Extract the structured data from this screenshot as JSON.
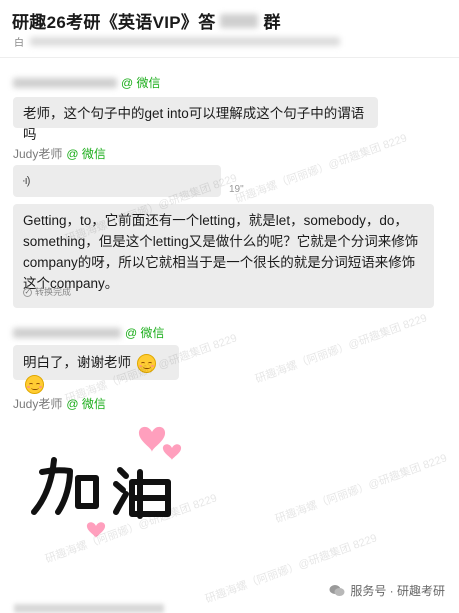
{
  "header": {
    "title": "研趣26考研《英语VIP》答",
    "title_tail": "群",
    "subtitle_prefix": "白"
  },
  "messages": [
    {
      "sender_suffix": "@ 微信",
      "text": "老师，这个句子中的get into可以理解成这个句子中的谓语吗"
    },
    {
      "sender": "Judy老师",
      "sender_suffix": "@ 微信"
    },
    {
      "sender_suffix": "@ 微信",
      "text": "明白了，谢谢老师"
    },
    {
      "sender": "Judy老师",
      "sender_suffix": "@ 微信"
    }
  ],
  "voice": {
    "duration": "19\"",
    "transcript": "Getting，to，它前面还有一个letting，就是let，somebody，do，something，但是这个letting又是做什么的呢？它就是个分词来修饰company的呀，所以它就相当于是一个很长的就是分词短语来修饰这个company。",
    "transcript_status": "转换完成"
  },
  "sticker": {
    "text": "加油"
  },
  "watermark": {
    "text": "研趣海螺（阿丽娜）@研趣集团 8229"
  },
  "footer": {
    "account": "服务号 · 研趣考研"
  },
  "colors": {
    "wechat_green": "#1aad19",
    "bubble": "#ececec",
    "heart": "#ff9fbd"
  }
}
